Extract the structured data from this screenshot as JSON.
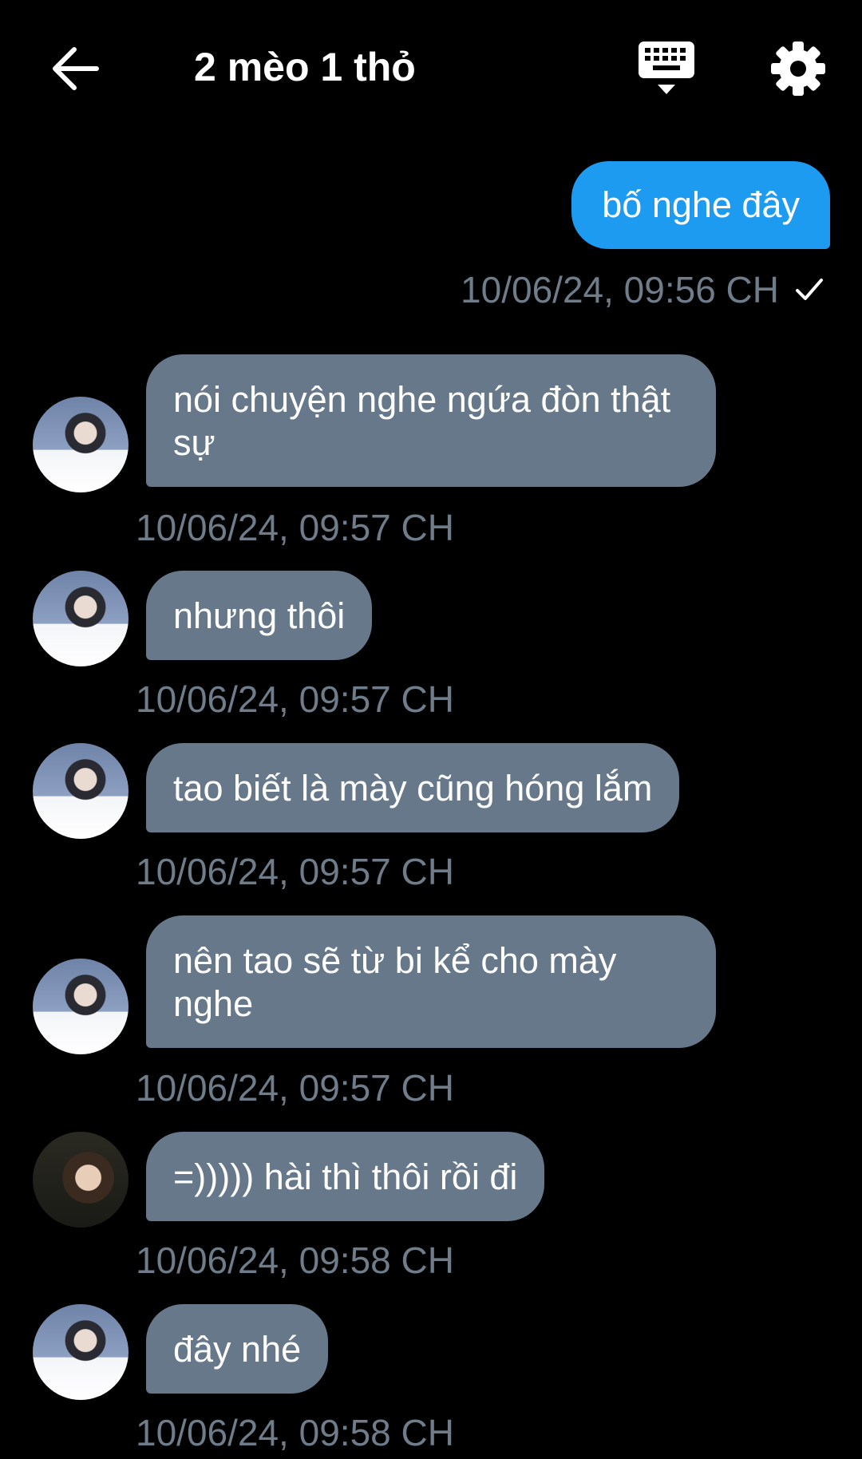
{
  "header": {
    "title": "2 mèo 1 thỏ",
    "back_icon": "arrow-left-icon",
    "keyboard_icon": "keyboard-icon",
    "settings_icon": "gear-icon"
  },
  "colors": {
    "background": "#000000",
    "outgoing_bubble": "#1d9bf0",
    "incoming_bubble": "#66788a",
    "timestamp": "#6f7c89"
  },
  "messages": [
    {
      "direction": "outgoing",
      "text": "bố nghe đây",
      "time": "10/06/24, 09:56 CH",
      "status_icon": "check-icon"
    },
    {
      "direction": "incoming",
      "text": "nói chuyện nghe ngứa đòn thật sự",
      "time": "10/06/24, 09:57 CH"
    },
    {
      "direction": "incoming",
      "text": "nhưng thôi",
      "time": "10/06/24, 09:57 CH"
    },
    {
      "direction": "incoming",
      "text": "tao biết là mày cũng hóng lắm",
      "time": "10/06/24, 09:57 CH"
    },
    {
      "direction": "incoming",
      "text": "nên tao sẽ từ bi kể cho mày nghe",
      "time": "10/06/24, 09:57 CH"
    },
    {
      "direction": "incoming",
      "text": "=))))) hài thì thôi rồi đi",
      "time": "10/06/24, 09:58 CH"
    },
    {
      "direction": "incoming",
      "text": "đây nhé",
      "time": "10/06/24, 09:58 CH"
    }
  ]
}
